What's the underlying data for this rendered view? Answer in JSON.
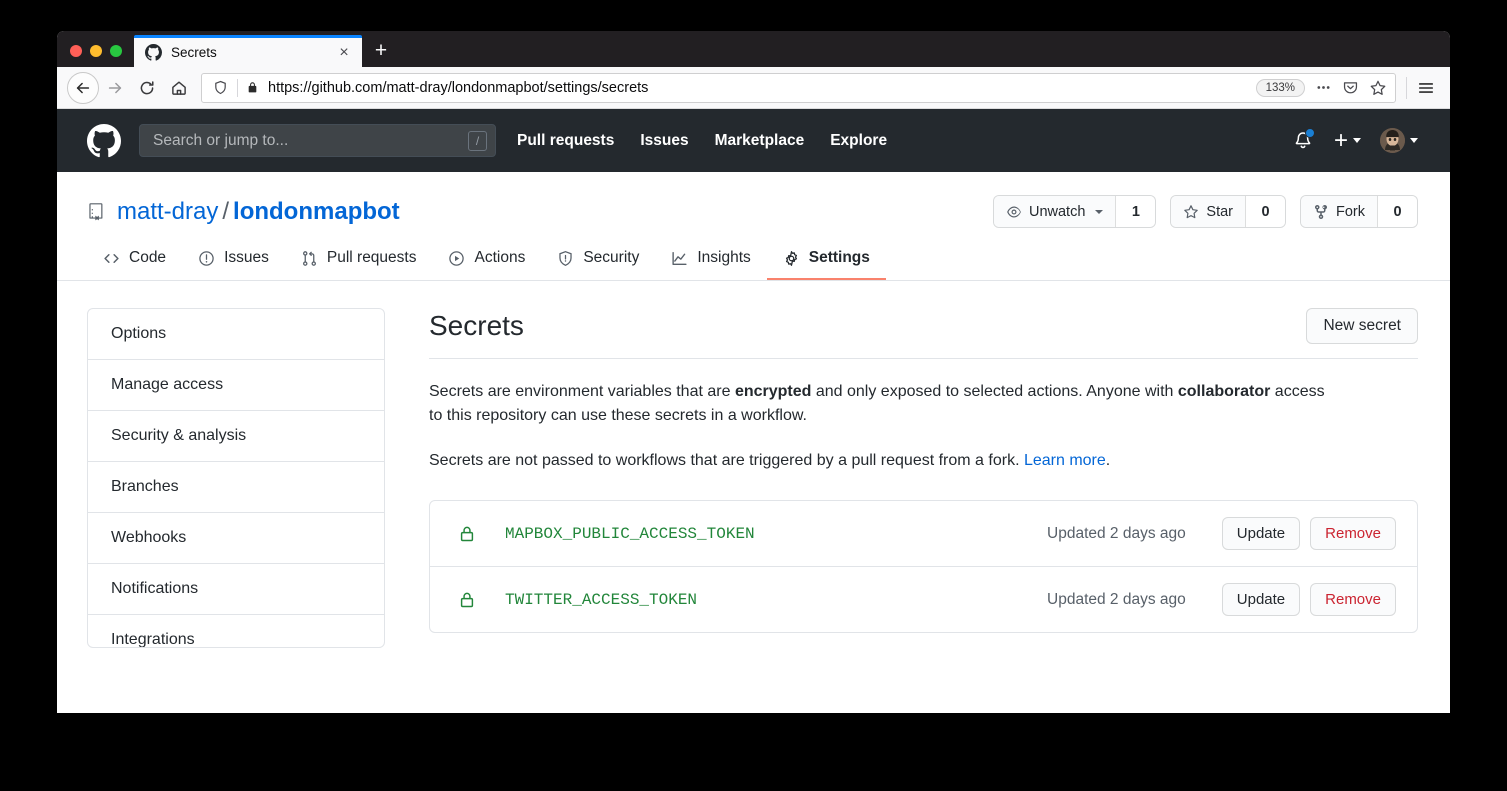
{
  "browser": {
    "tab": {
      "title": "Secrets",
      "favicon": "github-icon",
      "close": "×"
    },
    "new_tab_label": "+",
    "url": "https://github.com/matt-dray/londonmapbot/settings/secrets",
    "zoom_level": "133%",
    "nav_icons": [
      "back-icon",
      "forward-icon",
      "reload-icon",
      "home-icon"
    ],
    "urlbar_icons": [
      "shield-icon",
      "lock-icon"
    ],
    "action_icons": [
      "ellipsis-icon",
      "pocket-icon",
      "bookmark-star-icon"
    ],
    "menu_icon": "hamburger-icon"
  },
  "gh_header": {
    "logo": "github-logo-icon",
    "search": {
      "placeholder": "Search or jump to...",
      "value": "",
      "shortcut": "/"
    },
    "nav": [
      {
        "label": "Pull requests"
      },
      {
        "label": "Issues"
      },
      {
        "label": "Marketplace"
      },
      {
        "label": "Explore"
      }
    ],
    "notifications_icon": "bell-icon",
    "has_notification_dot": true,
    "create_new_label": "+",
    "avatar": "user-avatar"
  },
  "repo": {
    "icon": "repo-book-icon",
    "owner": "matt-dray",
    "separator": "/",
    "name": "londonmapbot",
    "actions": [
      {
        "name": "watch",
        "icon": "eye-icon",
        "label": "Unwatch",
        "count": "1",
        "has_caret": true
      },
      {
        "name": "star",
        "icon": "star-icon",
        "label": "Star",
        "count": "0",
        "has_caret": false
      },
      {
        "name": "fork",
        "icon": "fork-icon",
        "label": "Fork",
        "count": "0",
        "has_caret": false
      }
    ],
    "tabs": [
      {
        "label": "Code",
        "icon": "code-icon",
        "active": false
      },
      {
        "label": "Issues",
        "icon": "issue-opened-icon",
        "active": false
      },
      {
        "label": "Pull requests",
        "icon": "git-pull-request-icon",
        "active": false
      },
      {
        "label": "Actions",
        "icon": "play-icon",
        "active": false
      },
      {
        "label": "Security",
        "icon": "shield-icon",
        "active": false
      },
      {
        "label": "Insights",
        "icon": "graph-icon",
        "active": false
      },
      {
        "label": "Settings",
        "icon": "gear-icon",
        "active": true
      }
    ],
    "active_tab_color": "#f9826c"
  },
  "settings": {
    "sidebar": [
      {
        "label": "Options"
      },
      {
        "label": "Manage access"
      },
      {
        "label": "Security & analysis"
      },
      {
        "label": "Branches"
      },
      {
        "label": "Webhooks"
      },
      {
        "label": "Notifications"
      },
      {
        "label": "Integrations"
      }
    ],
    "page_title": "Secrets",
    "new_secret_label": "New secret",
    "description_1": {
      "part_1": "Secrets are environment variables that are ",
      "bold_1": "encrypted",
      "part_2": " and only exposed to selected actions. Anyone with ",
      "bold_2": "collaborator",
      "part_3": " access to this repository can use these secrets in a workflow."
    },
    "description_2": {
      "part_1": "Secrets are not passed to workflows that are triggered by a pull request from a fork. ",
      "link": "Learn more",
      "part_2": "."
    },
    "secrets": [
      {
        "icon": "lock-icon",
        "name": "MAPBOX_PUBLIC_ACCESS_TOKEN",
        "updated": "Updated 2 days ago",
        "update_label": "Update",
        "remove_label": "Remove"
      },
      {
        "icon": "lock-icon",
        "name": "TWITTER_ACCESS_TOKEN",
        "updated": "Updated 2 days ago",
        "update_label": "Update",
        "remove_label": "Remove"
      }
    ],
    "secret_name_color": "#22863a",
    "remove_color": "#cb2431",
    "link_color": "#0366d6"
  }
}
